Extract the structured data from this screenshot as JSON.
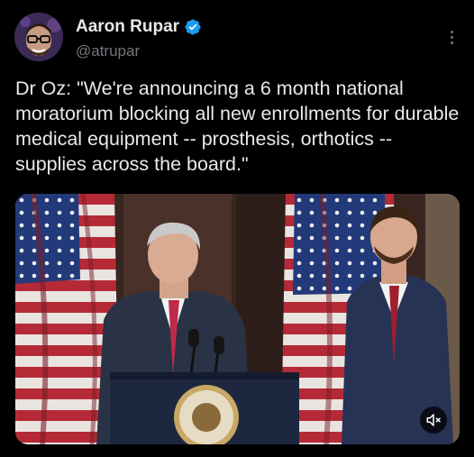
{
  "post": {
    "author": {
      "display_name": "Aaron Rupar",
      "handle": "@atrupar",
      "verified": true,
      "avatar_icon": "avatar-photo",
      "verified_icon": "verified-badge-icon"
    },
    "text": "Dr Oz: \"We're announcing a 6 month national moratorium blocking all new enrollments for durable medical equipment -- prosthesis, orthotics -- supplies across the board.\"",
    "more_icon": "more-options-icon"
  },
  "media": {
    "type": "video",
    "seal_text": "PRESIDENT OF THE UNITED STATES",
    "mute_icon": "speaker-muted-icon"
  },
  "colors": {
    "background": "#000000",
    "text": "#e7e9ea",
    "secondary_text": "#71767b",
    "verified_blue": "#1d9bf0"
  }
}
